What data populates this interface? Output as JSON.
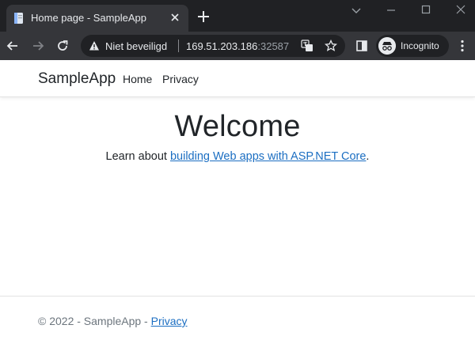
{
  "browser": {
    "tab_title": "Home page - SampleApp",
    "security_label": "Niet beveiligd",
    "url_host": "169.51.203.186",
    "url_port": ":32587",
    "profile_label": "Incognito"
  },
  "navbar": {
    "brand": "SampleApp",
    "links": [
      "Home",
      "Privacy"
    ]
  },
  "main": {
    "heading": "Welcome",
    "learn_prefix": "Learn about ",
    "learn_link": "building Web apps with ASP.NET Core",
    "learn_suffix": "."
  },
  "footer": {
    "copyright": "© 2022 - SampleApp - ",
    "privacy_link": "Privacy"
  },
  "colors": {
    "chrome_dark": "#202124",
    "chrome_toolbar": "#35363a",
    "link_blue": "#1b6ec2",
    "text": "#212529",
    "muted": "#6c757d"
  }
}
